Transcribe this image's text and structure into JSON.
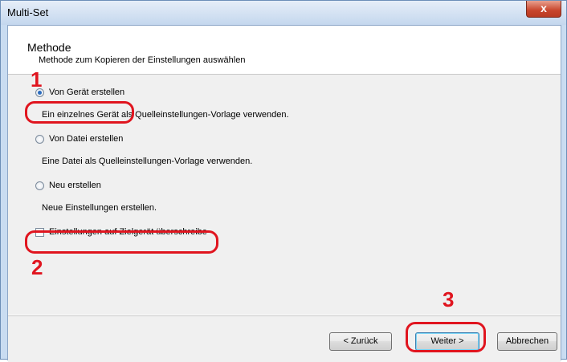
{
  "window": {
    "title": "Multi-Set",
    "close_label": "x"
  },
  "header": {
    "title": "Methode",
    "subtitle": "Methode zum Kopieren der Einstellungen auswählen"
  },
  "options": [
    {
      "label": "Von Gerät erstellen",
      "description": "Ein einzelnes Gerät als Quelleinstellungen-Vorlage verwenden.",
      "selected": true
    },
    {
      "label": "Von Datei erstellen",
      "description": "Eine Datei  als Quelleinstellungen-Vorlage verwenden.",
      "selected": false
    },
    {
      "label": "Neu erstellen",
      "description": "Neue Einstellungen erstellen.",
      "selected": false
    }
  ],
  "overwrite_checkbox": {
    "label": "Einstellungen auf Zielgerät überschreibe",
    "checked": false
  },
  "buttons": {
    "back": "< Zurück",
    "next": "Weiter >",
    "cancel": "Abbrechen"
  },
  "callouts": [
    "1",
    "2",
    "3"
  ],
  "colors": {
    "callout": "#e0151f",
    "radio_dot": "#2a6bbd",
    "close_button": "#c8452c"
  }
}
